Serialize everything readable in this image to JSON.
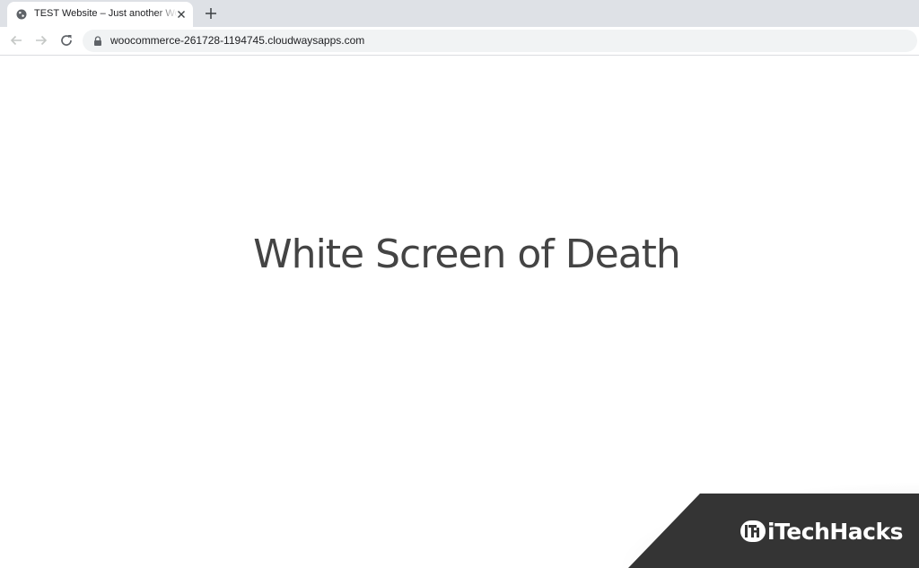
{
  "browser": {
    "tab": {
      "title": "TEST Website – Just another WordPress site",
      "favicon": "globe-icon",
      "close_icon": "close-icon"
    },
    "new_tab_icon": "plus-icon",
    "nav": {
      "back_icon": "arrow-left-icon",
      "forward_icon": "arrow-right-icon",
      "reload_icon": "reload-icon"
    },
    "address_bar": {
      "lock_icon": "lock-icon",
      "url": "woocommerce-261728-1194745.cloudwaysapps.com"
    }
  },
  "page": {
    "headline": "White Screen of Death"
  },
  "watermark": {
    "logo_icon": "itechhacks-logo-icon",
    "brand": "iTechHacks",
    "background": "#343434"
  }
}
